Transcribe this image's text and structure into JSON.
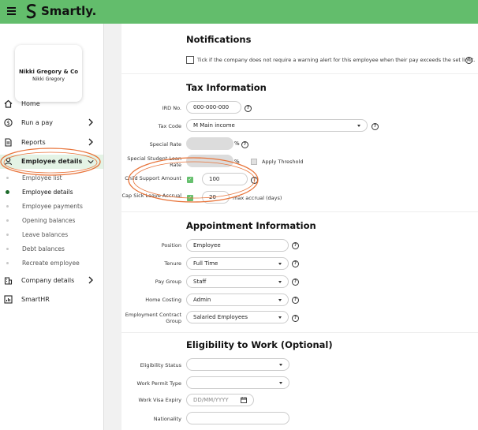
{
  "header": {
    "brand": "Smartly.",
    "accent_color": "#63bd6c"
  },
  "sidebar": {
    "company_name": "Nikki Gregory & Co",
    "company_user": "Nikki Gregory",
    "nav": [
      {
        "label": "Home",
        "icon": "home-icon"
      },
      {
        "label": "Run a pay",
        "icon": "dollar-icon"
      },
      {
        "label": "Reports",
        "icon": "document-icon"
      },
      {
        "label": "Employee details",
        "icon": "person-icon",
        "active": true
      },
      {
        "label": "Company details",
        "icon": "building-icon"
      },
      {
        "label": "SmartHR",
        "icon": "chart-icon"
      }
    ],
    "sub_items": [
      {
        "label": "Employee list"
      },
      {
        "label": "Employee details",
        "current": true
      },
      {
        "label": "Employee payments"
      },
      {
        "label": "Opening balances"
      },
      {
        "label": "Leave balances"
      },
      {
        "label": "Debt balances"
      },
      {
        "label": "Recreate employee"
      }
    ]
  },
  "notifications": {
    "title": "Notifications",
    "checkbox_label": "Tick if the company does not require a warning alert for this employee when their pay exceeds the set limit."
  },
  "tax": {
    "title": "Tax Information",
    "ird_label": "IRD No.",
    "ird_value": "000-000-000",
    "tax_code_label": "Tax Code",
    "tax_code_value": "M Main income",
    "special_rate_label": "Special Rate",
    "special_student_label": "Special Student Loan Rate",
    "apply_threshold_label": "Apply Threshold",
    "child_support_label": "Child Support Amount",
    "child_support_value": "100",
    "cap_sick_label": "Cap Sick Leave Accrual",
    "cap_sick_value": "20",
    "max_accrual_label": "max accrual (days)",
    "percent_symbol": "%"
  },
  "appointment": {
    "title": "Appointment Information",
    "position_label": "Position",
    "position_value": "Employee",
    "tenure_label": "Tenure",
    "tenure_value": "Full Time",
    "pay_group_label": "Pay Group",
    "pay_group_value": "Staff",
    "home_costing_label": "Home Costing",
    "home_costing_value": "Admin",
    "contract_group_label": "Employment Contract Group",
    "contract_group_value": "Salaried Employees"
  },
  "eligibility": {
    "title": "Eligibility to Work (Optional)",
    "status_label": "Eligibility Status",
    "permit_label": "Work Permit Type",
    "visa_expiry_label": "Work Visa Expiry",
    "visa_expiry_placeholder": "DD/MM/YYYY",
    "nationality_label": "Nationality"
  },
  "help_glyph": "?",
  "check_glyph": "✓"
}
